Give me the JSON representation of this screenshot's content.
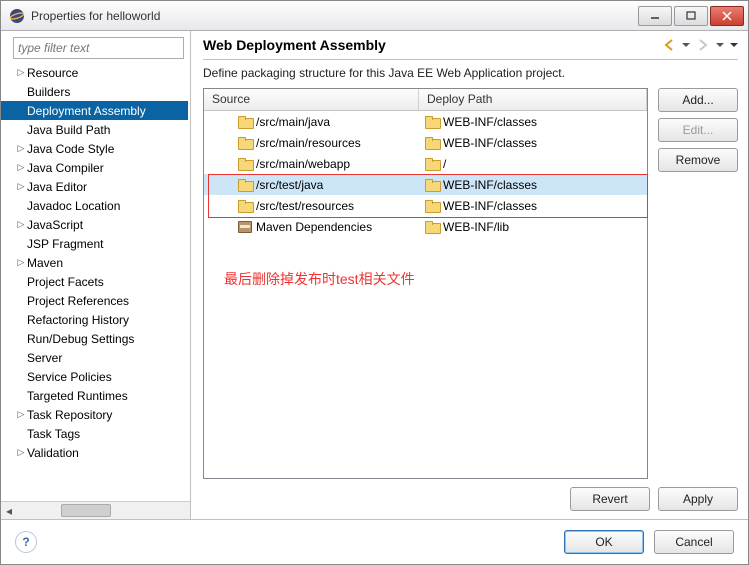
{
  "window": {
    "title": "Properties for helloworld"
  },
  "filter": {
    "placeholder": "type filter text"
  },
  "tree": {
    "items": [
      {
        "label": "Resource",
        "expandable": true
      },
      {
        "label": "Builders",
        "expandable": false
      },
      {
        "label": "Deployment Assembly",
        "expandable": false,
        "selected": true
      },
      {
        "label": "Java Build Path",
        "expandable": false
      },
      {
        "label": "Java Code Style",
        "expandable": true
      },
      {
        "label": "Java Compiler",
        "expandable": true
      },
      {
        "label": "Java Editor",
        "expandable": true
      },
      {
        "label": "Javadoc Location",
        "expandable": false
      },
      {
        "label": "JavaScript",
        "expandable": true
      },
      {
        "label": "JSP Fragment",
        "expandable": false
      },
      {
        "label": "Maven",
        "expandable": true
      },
      {
        "label": "Project Facets",
        "expandable": false
      },
      {
        "label": "Project References",
        "expandable": false
      },
      {
        "label": "Refactoring History",
        "expandable": false
      },
      {
        "label": "Run/Debug Settings",
        "expandable": false
      },
      {
        "label": "Server",
        "expandable": false
      },
      {
        "label": "Service Policies",
        "expandable": false
      },
      {
        "label": "Targeted Runtimes",
        "expandable": false
      },
      {
        "label": "Task Repository",
        "expandable": true
      },
      {
        "label": "Task Tags",
        "expandable": false
      },
      {
        "label": "Validation",
        "expandable": true
      }
    ]
  },
  "page": {
    "title": "Web Deployment Assembly",
    "description": "Define packaging structure for this Java EE Web Application project."
  },
  "table": {
    "columns": {
      "source": "Source",
      "deploy": "Deploy Path"
    },
    "rows": [
      {
        "icon": "folder",
        "source": "/src/main/java",
        "deploy": "WEB-INF/classes"
      },
      {
        "icon": "folder",
        "source": "/src/main/resources",
        "deploy": "WEB-INF/classes"
      },
      {
        "icon": "folder",
        "source": "/src/main/webapp",
        "deploy": "/"
      },
      {
        "icon": "folder",
        "source": "/src/test/java",
        "deploy": "WEB-INF/classes",
        "selected": true
      },
      {
        "icon": "folder",
        "source": "/src/test/resources",
        "deploy": "WEB-INF/classes"
      },
      {
        "icon": "jar",
        "source": "Maven Dependencies",
        "deploy": "WEB-INF/lib"
      }
    ]
  },
  "annotation": "最后删除掉发布时test相关文件",
  "buttons": {
    "add": "Add...",
    "edit": "Edit...",
    "remove": "Remove",
    "revert": "Revert",
    "apply": "Apply",
    "ok": "OK",
    "cancel": "Cancel"
  }
}
